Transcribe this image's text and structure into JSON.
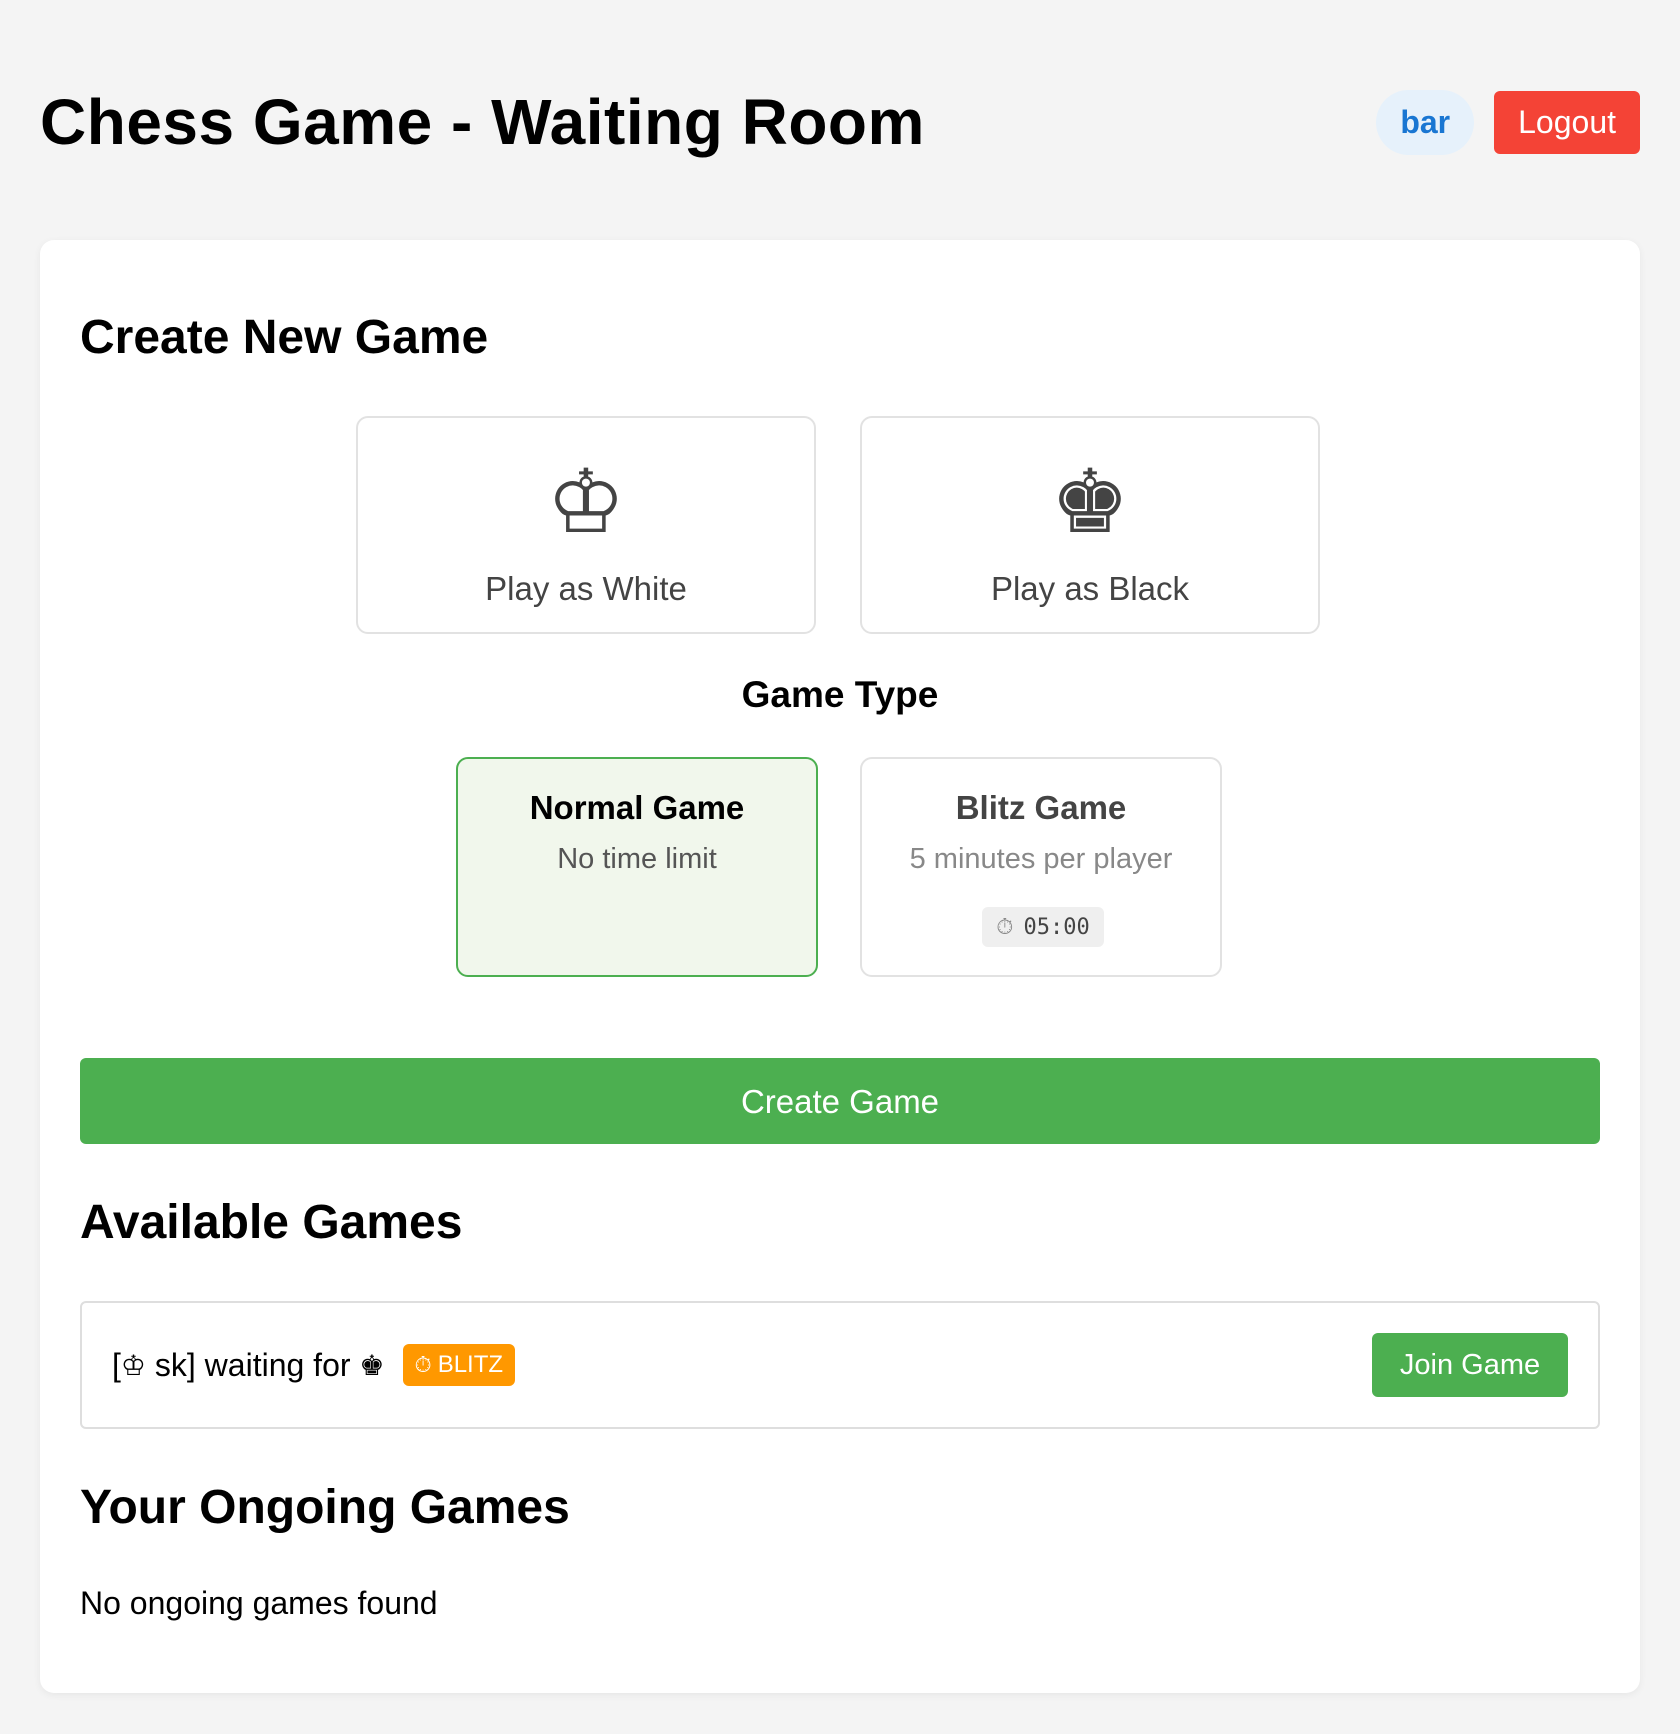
{
  "header": {
    "title": "Chess Game - Waiting Room",
    "username": "bar",
    "logout_label": "Logout"
  },
  "create": {
    "title": "Create New Game",
    "colors": [
      {
        "piece": "♔",
        "label": "Play as White"
      },
      {
        "piece": "♚",
        "label": "Play as Black"
      }
    ],
    "game_type_title": "Game Type",
    "types": [
      {
        "name": "Normal Game",
        "description": "No time limit",
        "selected": true
      },
      {
        "name": "Blitz Game",
        "description": "5 minutes per player",
        "timer": "05:00",
        "selected": false
      }
    ],
    "create_button_label": "Create Game"
  },
  "available": {
    "title": "Available Games",
    "games": [
      {
        "open_bracket": "[",
        "host_piece": "♔",
        "host_text": " sk] waiting for ",
        "wanted_piece": "♚",
        "badge_icon": "⏱",
        "badge_label": "BLITZ",
        "join_label": "Join Game"
      }
    ]
  },
  "ongoing": {
    "title": "Your Ongoing Games",
    "empty_text": "No ongoing games found"
  },
  "colors": {
    "green": "#4caf50",
    "red": "#f44336",
    "orange": "#ff9800",
    "blue": "#1976d2"
  }
}
